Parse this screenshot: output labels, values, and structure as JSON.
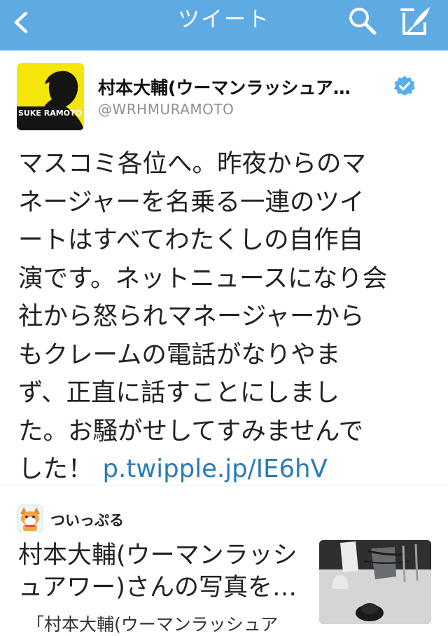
{
  "navbar": {
    "title": "ツイート",
    "back_icon": "chevron-left-icon",
    "search_icon": "search-icon",
    "compose_icon": "compose-icon",
    "background_color": "#5eaae3"
  },
  "tweet": {
    "author_name": "村本大輔(ウーマンラッシュア…",
    "author_handle": "@WRHMURAMOTO",
    "avatar_text": "SUKE RAMOTO",
    "verified": true,
    "text_lines": [
      "マスコミ各位へ。昨夜からのマ",
      "ネージャーを名乗る一連のツイ",
      "ートはすべてわたくしの自作自",
      "演です。ネットニュースになり会",
      "社から怒られマネージャーから",
      "もクレームの電話がなりやま",
      "ず、正直に話すことにしまし",
      "た。お騒がせしてすみませんで",
      "した！"
    ],
    "link_text": "p.twipple.jp/IE6hV",
    "link_color": "#2a7cb8"
  },
  "card": {
    "app_name": "ついっぷる",
    "title_lines": [
      "村本大輔(ウーマンラッシ",
      "ュアワー)さんの写真を…"
    ],
    "description": "「村本大輔(ウーマンラッシュア"
  }
}
